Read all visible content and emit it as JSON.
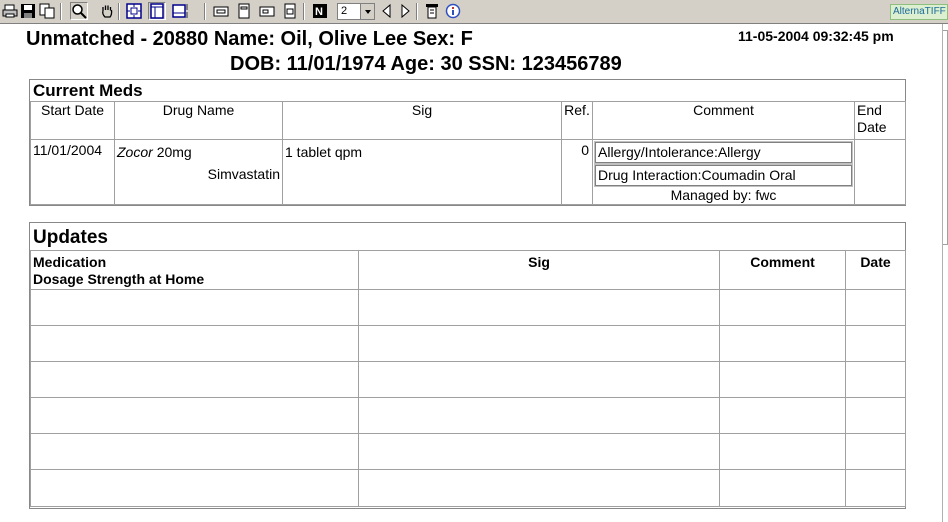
{
  "toolbar": {
    "page_value": "2",
    "brand": "AlternaTIFF",
    "icons": [
      "printer-icon",
      "save-icon",
      "copy-icon",
      "zoom-icon",
      "hand-pan-icon",
      "fit-page-icon",
      "fit-width-icon",
      "fit-height-icon",
      "page-view-icon",
      "single-page-icon",
      "page-width-icon",
      "page-height-icon",
      "invert-icon",
      "previous-page-icon",
      "next-page-icon",
      "properties-icon",
      "info-icon"
    ]
  },
  "header": {
    "line1": "Unmatched - 20880 Name: Oil, Olive Lee Sex: F",
    "line2": "DOB: 11/01/1974 Age: 30 SSN: 123456789",
    "timestamp": "11-05-2004 09:32:45 pm"
  },
  "current_meds": {
    "title": "Current Meds",
    "columns": {
      "start_date": "Start Date",
      "drug_name": "Drug Name",
      "sig": "Sig",
      "ref": "Ref.",
      "comment": "Comment",
      "end_date": "End Date"
    },
    "rows": [
      {
        "start_date": "11/01/2004",
        "brand_name": "Zocor",
        "strength": "20mg",
        "generic_name": "Simvastatin",
        "sig": "1 tablet qpm",
        "ref": "0",
        "comment_1": "Allergy/Intolerance:Allergy",
        "comment_2": "Drug Interaction:Coumadin Oral",
        "managed_by": "Managed by: fwc",
        "end_date": ""
      }
    ]
  },
  "updates": {
    "title": "Updates",
    "columns": {
      "medication": "Medication",
      "dosage": "Dosage Strength at Home",
      "sig": "Sig",
      "comment": "Comment",
      "date": "Date"
    }
  },
  "colors": {
    "toolbar_bg": "#d4d0c8",
    "grid_border": "#a0a0a0",
    "brand_text": "#1a6b9a"
  }
}
